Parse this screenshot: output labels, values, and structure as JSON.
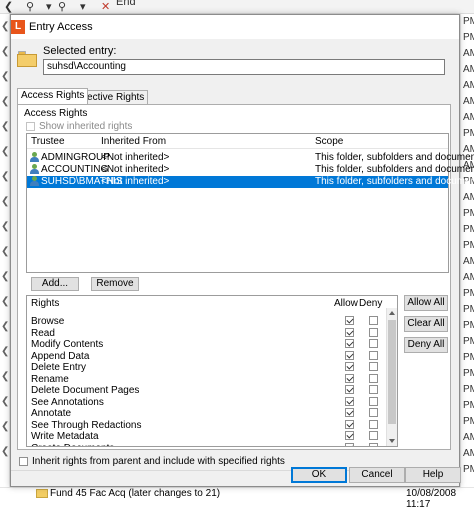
{
  "background": {
    "toolbar_end": "End",
    "right_strip": [
      "PM",
      "PM",
      "AM",
      "AM",
      "AM",
      "AM",
      "AM",
      "PM",
      "AM",
      "AM",
      "PM",
      "AM",
      "PM",
      "PM",
      "PM",
      "AM",
      "AM",
      "PM",
      "PM",
      "PM",
      "PM",
      "PM",
      "PM",
      "PM",
      "PM",
      "PM",
      "AM",
      "AM",
      "PM"
    ],
    "bottom_file": "Fund 45 Fac Acq (later changes to 21)",
    "bottom_date": "10/08/2008 11:17"
  },
  "dialog": {
    "title": "Entry Access",
    "selected_entry_label": "Selected entry:",
    "selected_entry_value": "suhsd\\Accounting",
    "tabs": [
      "Access Rights",
      "Effective Rights"
    ],
    "access_rights_label": "Access Rights",
    "show_inherited_label": "Show inherited rights",
    "trustee_headers": {
      "trustee": "Trustee",
      "inherited": "Inherited From",
      "scope": "Scope"
    },
    "trustees": [
      {
        "name": "ADMINGROUP",
        "inherited": "<Not inherited>",
        "scope": "This folder, subfolders and documents",
        "selected": false
      },
      {
        "name": "ACCOUNTING",
        "inherited": "<Not inherited>",
        "scope": "This folder, subfolders and documents",
        "selected": false
      },
      {
        "name": "SUHSD\\BMATHIS",
        "inherited": "<Not inherited>",
        "scope": "This folder, subfolders and documents",
        "selected": true
      }
    ],
    "add_label": "Add...",
    "remove_label": "Remove",
    "rights_headers": {
      "rights": "Rights",
      "allow": "Allow",
      "deny": "Deny"
    },
    "rights": [
      {
        "label": "Browse",
        "allow": true,
        "deny": false
      },
      {
        "label": "Read",
        "allow": true,
        "deny": false
      },
      {
        "label": "Modify Contents",
        "allow": true,
        "deny": false
      },
      {
        "label": "Append Data",
        "allow": true,
        "deny": false
      },
      {
        "label": "Delete Entry",
        "allow": true,
        "deny": false
      },
      {
        "label": "Rename",
        "allow": true,
        "deny": false
      },
      {
        "label": "Delete Document Pages",
        "allow": true,
        "deny": false
      },
      {
        "label": "See Annotations",
        "allow": true,
        "deny": false
      },
      {
        "label": "Annotate",
        "allow": true,
        "deny": false
      },
      {
        "label": "See Through Redactions",
        "allow": true,
        "deny": false
      },
      {
        "label": "Write Metadata",
        "allow": true,
        "deny": false
      },
      {
        "label": "Create Documents",
        "allow": true,
        "deny": false
      }
    ],
    "allow_all_label": "Allow All",
    "clear_all_label": "Clear All",
    "deny_all_label": "Deny All",
    "inherit_label": "Inherit rights from parent and include with specified rights",
    "ok_label": "OK",
    "cancel_label": "Cancel",
    "help_label": "Help"
  }
}
